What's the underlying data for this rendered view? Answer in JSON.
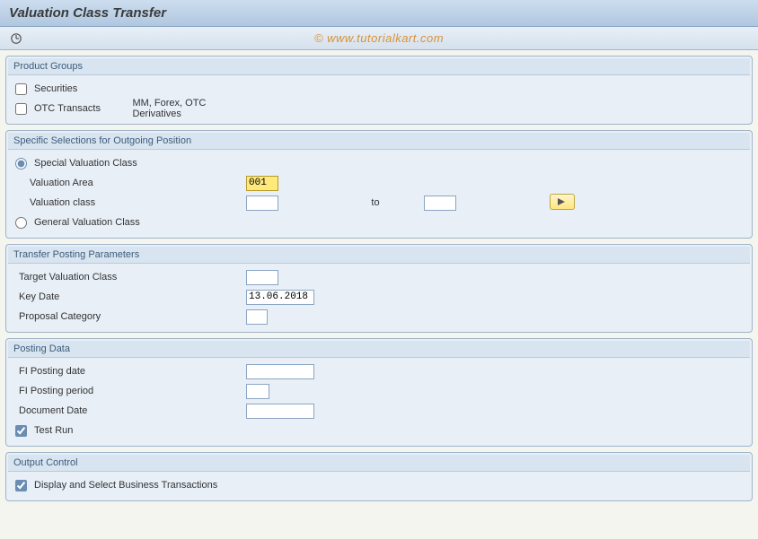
{
  "title": "Valuation Class Transfer",
  "watermark": "© www.tutorialkart.com",
  "groups": {
    "product": {
      "title": "Product Groups",
      "securities_label": "Securities",
      "securities_checked": false,
      "otc_label": "OTC Transacts",
      "otc_checked": false,
      "otc_desc": "MM, Forex, OTC Derivatives"
    },
    "selections": {
      "title": "Specific Selections for Outgoing Position",
      "special_radio_label": "Special Valuation Class",
      "general_radio_label": "General Valuation Class",
      "selected_radio": "special",
      "valuation_area_label": "Valuation Area",
      "valuation_area_value": "001",
      "valuation_class_label": "Valuation class",
      "valuation_class_from": "",
      "to_label": "to",
      "valuation_class_to": ""
    },
    "transfer": {
      "title": "Transfer Posting Parameters",
      "target_class_label": "Target Valuation Class",
      "target_class_value": "",
      "key_date_label": "Key Date",
      "key_date_value": "13.06.2018",
      "proposal_cat_label": "Proposal Category",
      "proposal_cat_value": ""
    },
    "posting": {
      "title": "Posting Data",
      "fi_date_label": "FI Posting date",
      "fi_date_value": "",
      "fi_period_label": "FI Posting period",
      "fi_period_value": "",
      "doc_date_label": "Document Date",
      "doc_date_value": "",
      "test_run_label": "Test Run",
      "test_run_checked": true
    },
    "output": {
      "title": "Output Control",
      "display_label": "Display and Select Business Transactions",
      "display_checked": true
    }
  }
}
